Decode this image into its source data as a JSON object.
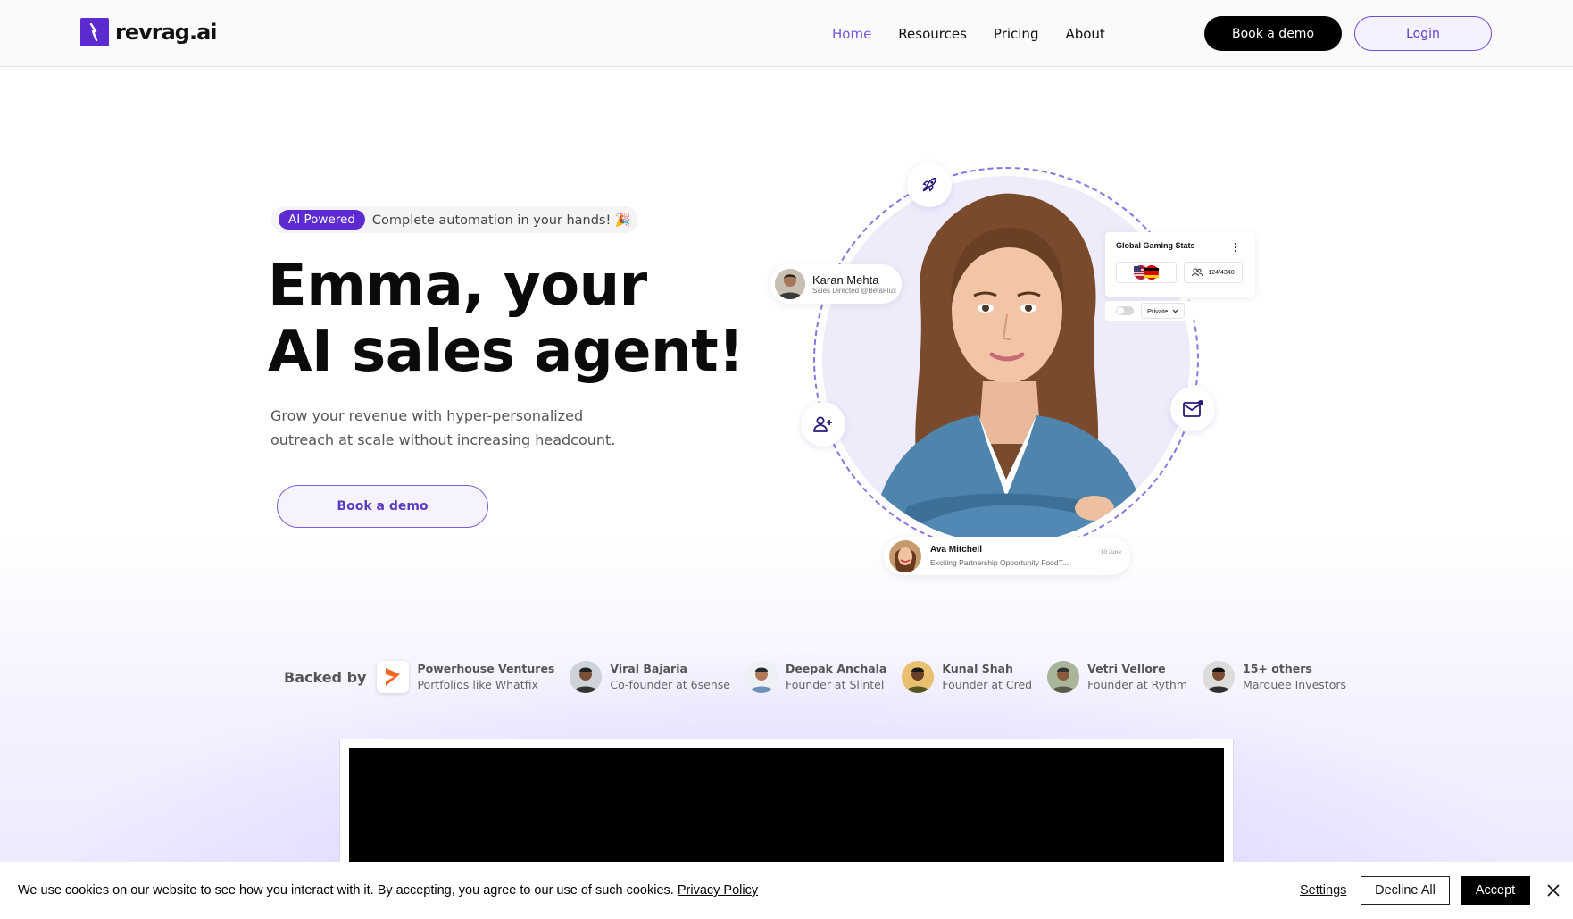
{
  "brand": {
    "name": "revrag.ai",
    "accent": "#5b2bd1"
  },
  "nav": {
    "items": [
      {
        "label": "Home",
        "active": true
      },
      {
        "label": "Resources",
        "active": false
      },
      {
        "label": "Pricing",
        "active": false
      },
      {
        "label": "About",
        "active": false
      }
    ],
    "book_demo": "Book a demo",
    "login": "Login"
  },
  "hero": {
    "badge": "AI Powered",
    "tagline": "Complete automation in your hands! 🎉",
    "title_line1": "Emma, your",
    "title_line2": "AI sales agent!",
    "subtitle": "Grow your revenue with hyper-personalized outreach at scale without increasing headcount.",
    "cta": "Book a demo"
  },
  "visual": {
    "contact_card": {
      "name": "Karan Mehta",
      "role": "Sales Directed @BetaFlux"
    },
    "stats_card": {
      "title": "Global Gaming Stats",
      "count": "124/4340",
      "visibility": "Private"
    },
    "message_card": {
      "name": "Ava Mitchell",
      "preview": "Exciting Partnership Opportunity FoodT...",
      "date": "10 June"
    },
    "icons": [
      "rocket-icon",
      "add-user-icon",
      "mail-icon"
    ]
  },
  "backers": {
    "label": "Backed by",
    "items": [
      {
        "name": "Powerhouse Ventures",
        "role": "Portfolios like Whatfix"
      },
      {
        "name": "Viral Bajaria",
        "role": "Co-founder at 6sense"
      },
      {
        "name": "Deepak Anchala",
        "role": "Founder at Slintel"
      },
      {
        "name": "Kunal Shah",
        "role": "Founder at Cred"
      },
      {
        "name": "Vetri Vellore",
        "role": "Founder at Rythm"
      },
      {
        "name": "15+ others",
        "role": "Marquee Investors"
      }
    ]
  },
  "cookie": {
    "text": "We use cookies on our website to see how you interact with it. By accepting, you agree to our use of such cookies.",
    "policy_link": "Privacy Policy",
    "settings": "Settings",
    "decline": "Decline All",
    "accept": "Accept"
  }
}
